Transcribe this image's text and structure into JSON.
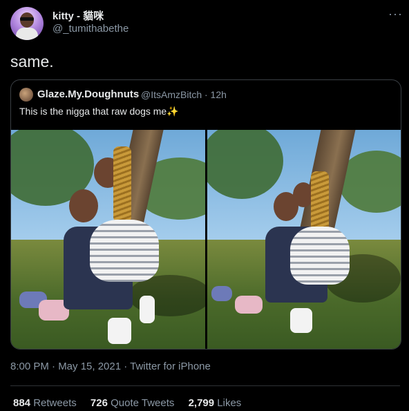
{
  "tweet": {
    "display_name": "kitty - 貓咪",
    "handle": "@_tumithabethe",
    "more_glyph": "···",
    "text": "same."
  },
  "quoted_tweet": {
    "display_name": "Glaze.My.Doughnuts",
    "handle_time": "@ItsAmzBitch · 12h",
    "text": "This is the nigga that raw dogs me",
    "emoji": "✨"
  },
  "meta": {
    "timestamp": "8:00 PM · May 15, 2021 · Twitter for iPhone"
  },
  "stats": {
    "retweets_count": "884",
    "retweets_label": "Retweets",
    "quotes_count": "726",
    "quotes_label": "Quote Tweets",
    "likes_count": "2,799",
    "likes_label": "Likes"
  },
  "colors": {
    "background": "#000000",
    "primary_text": "#e7e9ea",
    "secondary_text": "#8b98a5",
    "border": "#3a3f44"
  },
  "icons": [
    "more-options-icon",
    "sparkles-emoji-icon"
  ]
}
